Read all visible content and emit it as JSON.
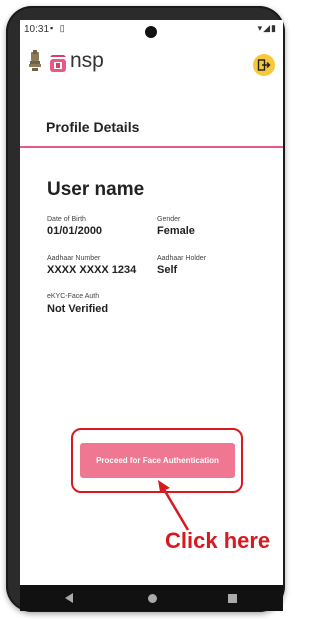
{
  "status": {
    "time": "10:31",
    "left_icons": "▪ ▯",
    "right_icons": "▾◢▮"
  },
  "header": {
    "logo_text": "nsp",
    "colors": {
      "brand_pink": "#e85a86",
      "logout_yellow": "#f7c83b"
    },
    "logout_icon": "logout-icon"
  },
  "profile": {
    "title": "Profile Details",
    "user_name": "User name",
    "fields": [
      {
        "label": "Date of Birth",
        "value": "01/01/2000"
      },
      {
        "label": "Gender",
        "value": "Female"
      },
      {
        "label": "Aadhaar Number",
        "value": "XXXX XXXX 1234"
      },
      {
        "label": "Aadhaar Holder",
        "value": "Self"
      },
      {
        "label": "eKYC-Face Auth",
        "value": "Not Verified"
      }
    ]
  },
  "action": {
    "button_label": "Proceed for Face Authentication",
    "annotation": "Click here",
    "annotation_color": "#d71920"
  },
  "nav": {
    "back_icon": "back-icon",
    "home_icon": "home-icon",
    "recents_icon": "recents-icon"
  }
}
